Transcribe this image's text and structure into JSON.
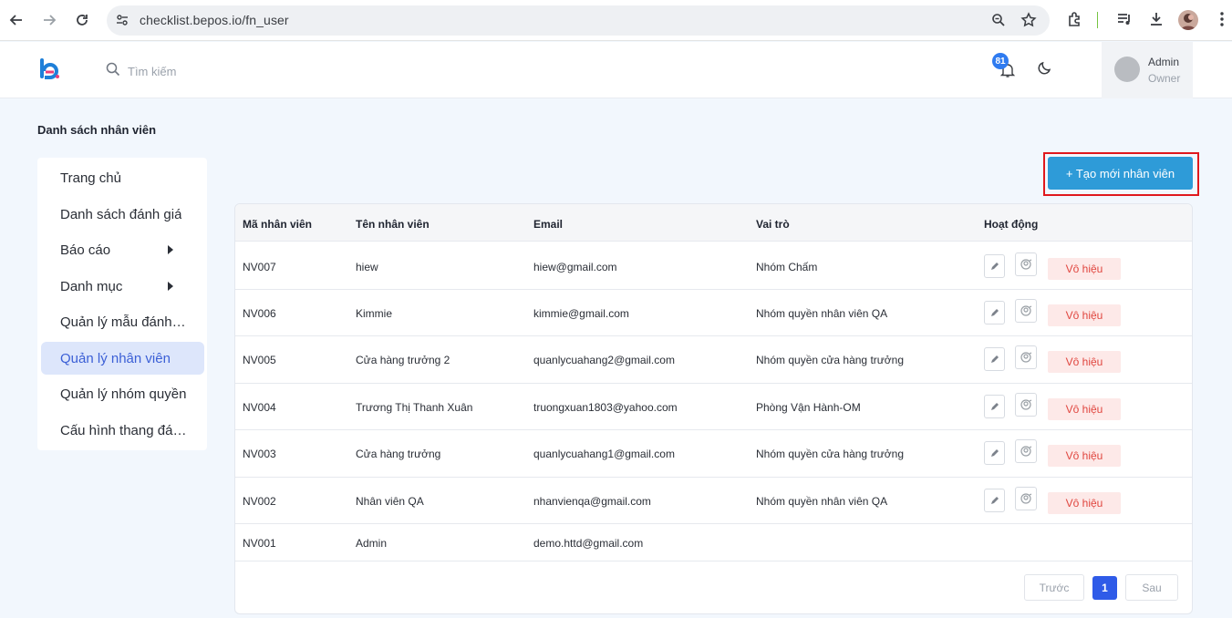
{
  "browser": {
    "url": "checklist.bepos.io/fn_user"
  },
  "header": {
    "search_placeholder": "Tìm kiếm",
    "notification_count": "81",
    "user_name": "Admin",
    "user_role": "Owner"
  },
  "page": {
    "title": "Danh sách nhân viên",
    "create_button": "+ Tạo mới nhân viên"
  },
  "sidebar": {
    "items": [
      {
        "label": "Trang chủ",
        "has_submenu": false,
        "active": false
      },
      {
        "label": "Danh sách đánh giá",
        "has_submenu": false,
        "active": false
      },
      {
        "label": "Báo cáo",
        "has_submenu": true,
        "active": false
      },
      {
        "label": "Danh mục",
        "has_submenu": true,
        "active": false
      },
      {
        "label": "Quản lý mẫu đánh giá",
        "has_submenu": false,
        "active": false
      },
      {
        "label": "Quản lý nhân viên",
        "has_submenu": false,
        "active": true
      },
      {
        "label": "Quản lý nhóm quyền",
        "has_submenu": false,
        "active": false
      },
      {
        "label": "Cấu hình thang đánh giá",
        "has_submenu": false,
        "active": false
      }
    ]
  },
  "table": {
    "columns": [
      "Mã nhân viên",
      "Tên nhân viên",
      "Email",
      "Vai trò",
      "Hoạt động"
    ],
    "disable_label": "Vô hiệu",
    "rows": [
      {
        "id": "NV007",
        "name": "hiew",
        "email": "hiew@gmail.com",
        "role": "Nhóm Chấm",
        "actions": true
      },
      {
        "id": "NV006",
        "name": "Kimmie",
        "email": "kimmie@gmail.com",
        "role": "Nhóm quyền nhân viên QA",
        "actions": true
      },
      {
        "id": "NV005",
        "name": "Cửa hàng trưởng 2",
        "email": "quanlycuahang2@gmail.com",
        "role": "Nhóm quyền cửa hàng trưởng",
        "actions": true
      },
      {
        "id": "NV004",
        "name": "Trương Thị Thanh Xuân",
        "email": "truongxuan1803@yahoo.com",
        "role": "Phòng Vận Hành-OM",
        "actions": true
      },
      {
        "id": "NV003",
        "name": "Cửa hàng trưởng",
        "email": "quanlycuahang1@gmail.com",
        "role": "Nhóm quyền cửa hàng trưởng",
        "actions": true
      },
      {
        "id": "NV002",
        "name": "Nhân viên QA",
        "email": "nhanvienqa@gmail.com",
        "role": "Nhóm quyền nhân viên QA",
        "actions": true
      },
      {
        "id": "NV001",
        "name": "Admin",
        "email": "demo.httd@gmail.com",
        "role": "",
        "actions": false
      }
    ]
  },
  "pagination": {
    "prev": "Trước",
    "current": "1",
    "next": "Sau"
  },
  "colors": {
    "primary": "#2e9bd8",
    "active_page": "#2f5be8",
    "highlight": "#e0181d",
    "disable_bg": "#fde9e8",
    "disable_text": "#e0463f"
  }
}
